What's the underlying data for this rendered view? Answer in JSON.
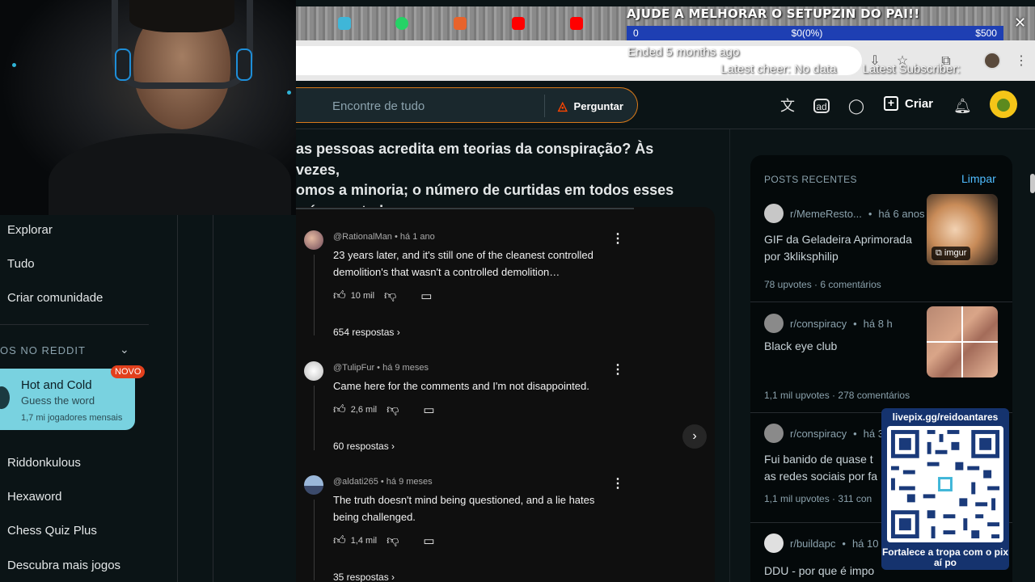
{
  "overlay": {
    "donation_title": "AJUDE A MELHORAR O SETUPZIN DO PAI!!",
    "goal_start": "0",
    "goal_progress": "$0(0%)",
    "goal_target": "$500",
    "goal_fraction": 0,
    "ended": "Ended 5 months ago",
    "latest_cheer": "Latest cheer: No data",
    "latest_subscriber": "Latest Subscriber:",
    "qr_url": "livepix.gg/reidoantares",
    "qr_caption": "Fortalece a tropa com o pix aí po"
  },
  "header": {
    "search_placeholder": "Encontre de tudo",
    "ask_label": "Perguntar",
    "create_label": "Criar"
  },
  "sidebar": {
    "items": [
      "Explorar",
      "Tudo",
      "Criar comunidade"
    ],
    "section": "OS NO REDDIT",
    "game": {
      "title": "Hot and Cold",
      "subtitle": "Guess the word",
      "players": "1,7 mi jogadores mensais",
      "badge": "NOVO"
    },
    "games": [
      "Riddonkulous",
      "Hexaword",
      "Chess Quiz Plus",
      "Descubra mais jogos"
    ]
  },
  "post": {
    "title_lines": [
      "as pessoas acredita em teorias da conspiração? Às vezes,",
      "omos a minoria; o número de curtidas em todos esses",
      "s é assustador."
    ]
  },
  "comments": [
    {
      "author": "@RationalMan",
      "age": "há 1 ano",
      "text": "23 years later, and it's still one of the cleanest controlled demolition's that wasn't a controlled demolition…",
      "likes": "10 mil",
      "replies": "654 respostas"
    },
    {
      "author": "@TulipFur",
      "age": "há 9 meses",
      "text": "Came here for the comments and I'm not disappointed.",
      "likes": "2,6 mil",
      "replies": "60 respostas"
    },
    {
      "author": "@aldati265",
      "age": "há 9 meses",
      "text": "The truth doesn't mind being questioned, and a lie hates being challenged.",
      "likes": "1,4 mil",
      "replies": "35 respostas"
    }
  ],
  "recent": {
    "heading": "POSTS RECENTES",
    "clear_label": "Limpar",
    "posts": [
      {
        "sub": "r/MemeResto...",
        "age": "há 6 anos",
        "title": "GIF da Geladeira Aprimorada por 3kliksphilip",
        "upvotes": "78 upvotes",
        "comments": "6 comentários",
        "thumb_label": "imgur"
      },
      {
        "sub": "r/conspiracy",
        "age": "há 8 h",
        "title": "Black eye club",
        "upvotes": "1,1 mil upvotes",
        "comments": "278 comentários"
      },
      {
        "sub": "r/conspiracy",
        "age": "há 3",
        "title": "Fui banido de quase t as redes sociais por fa",
        "upvotes": "1,1 mil upvotes",
        "comments": "311 con"
      },
      {
        "sub": "r/buildapc",
        "age": "há 10 r",
        "title": "DDU - por que é impo"
      }
    ]
  },
  "colors": {
    "accent_orange": "#d97a1a",
    "link_blue": "#4fbcff",
    "badge_red": "#e2401d",
    "game_card": "#79d2e0",
    "goal_bar": "#1e3fb3"
  }
}
